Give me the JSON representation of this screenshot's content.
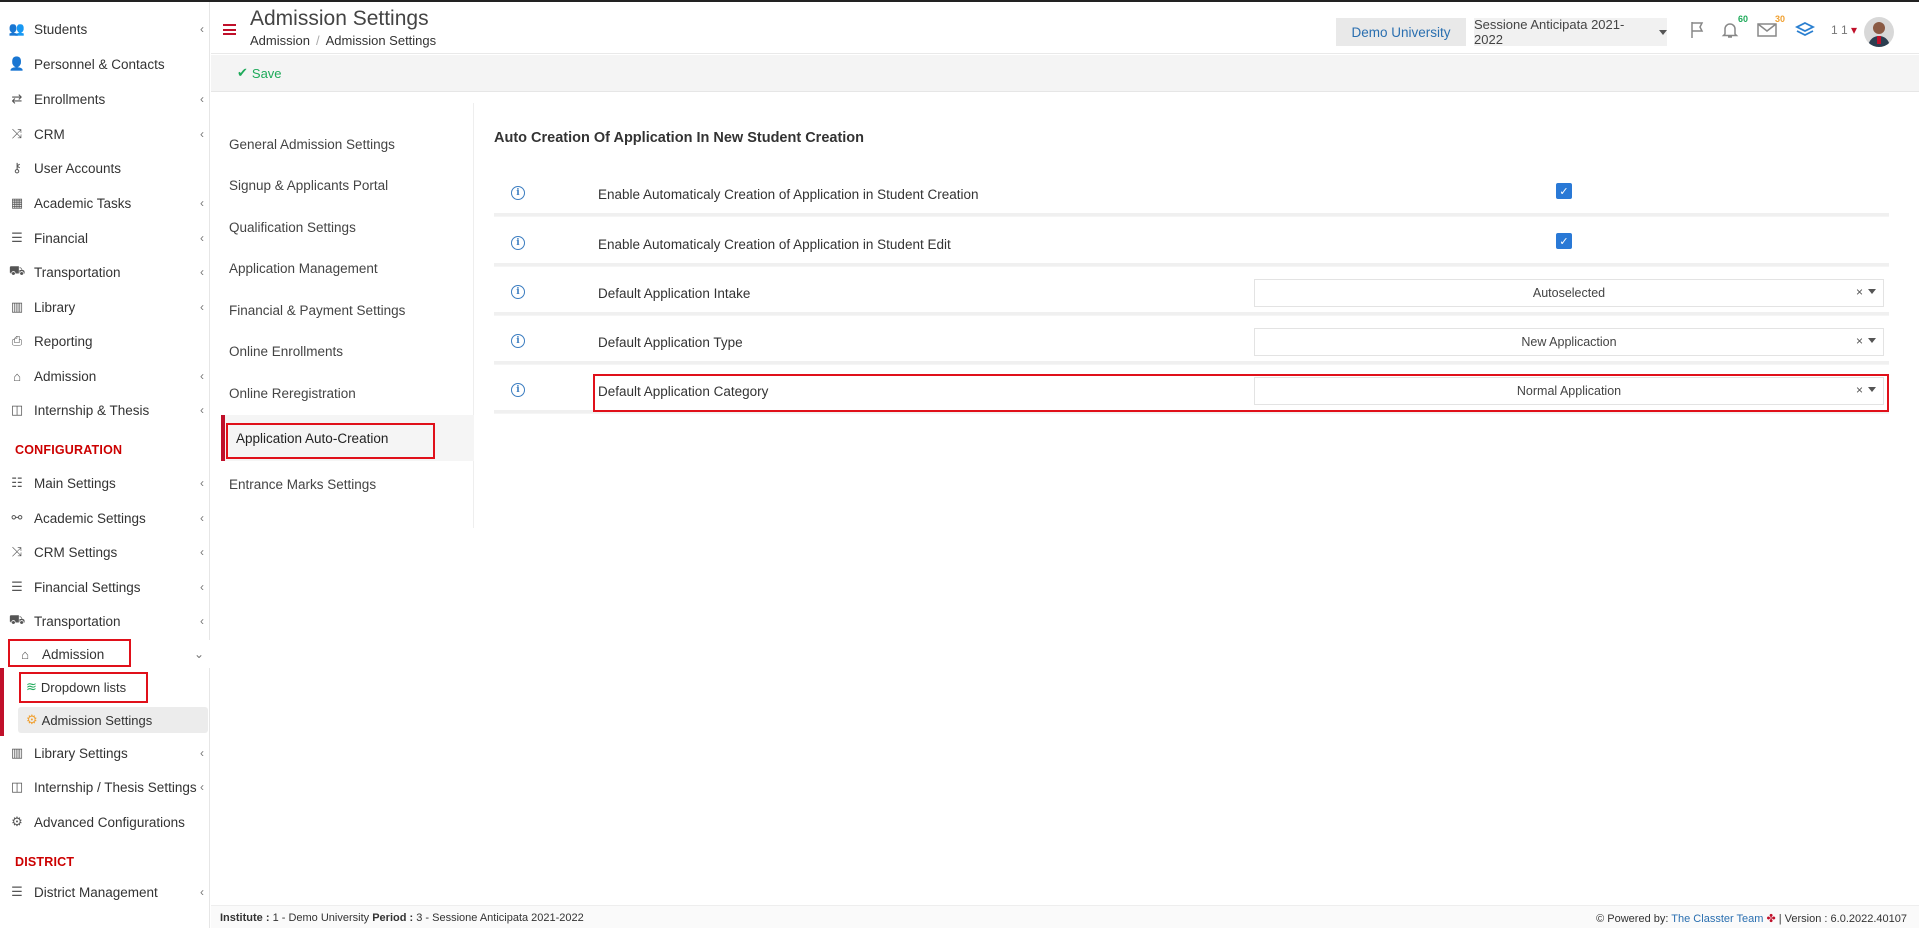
{
  "header": {
    "title": "Admission Settings",
    "breadcrumb": [
      "Admission",
      "Admission Settings"
    ],
    "institution": "Demo University",
    "session": "Sessione Anticipata 2021-2022",
    "notifications_badge": "60",
    "messages_badge": "30",
    "user_number": "1 1"
  },
  "toolbar": {
    "save_label": "Save"
  },
  "sidebar": {
    "items": [
      {
        "label": "Students",
        "icon": "users-icon",
        "chev": true
      },
      {
        "label": "Personnel & Contacts",
        "icon": "user-tie-icon",
        "chev": false
      },
      {
        "label": "Enrollments",
        "icon": "exchange-icon",
        "chev": true
      },
      {
        "label": "CRM",
        "icon": "shuffle-icon",
        "chev": true
      },
      {
        "label": "User Accounts",
        "icon": "key-icon",
        "chev": false
      },
      {
        "label": "Academic Tasks",
        "icon": "grid-icon",
        "chev": true
      },
      {
        "label": "Financial",
        "icon": "coins-icon",
        "chev": true
      },
      {
        "label": "Transportation",
        "icon": "bus-icon",
        "chev": true
      },
      {
        "label": "Library",
        "icon": "books-icon",
        "chev": true
      },
      {
        "label": "Reporting",
        "icon": "print-icon",
        "chev": false
      },
      {
        "label": "Admission",
        "icon": "bank-icon",
        "chev": true
      },
      {
        "label": "Internship & Thesis",
        "icon": "box-icon",
        "chev": true
      }
    ],
    "config_heading": "CONFIGURATION",
    "config_items": [
      {
        "label": "Main Settings",
        "icon": "sliders-icon",
        "chev": true
      },
      {
        "label": "Academic Settings",
        "icon": "org-icon",
        "chev": true
      },
      {
        "label": "CRM Settings",
        "icon": "shuffle-icon",
        "chev": true
      },
      {
        "label": "Financial Settings",
        "icon": "coins-icon",
        "chev": true
      },
      {
        "label": "Transportation",
        "icon": "bus-icon",
        "chev": true
      },
      {
        "label": "Admission",
        "icon": "bank-icon",
        "chev": true
      },
      {
        "label": "Library Settings",
        "icon": "books-icon",
        "chev": true
      },
      {
        "label": "Internship / Thesis Settings",
        "icon": "box-icon",
        "chev": true
      },
      {
        "label": "Advanced Configurations",
        "icon": "gears-icon",
        "chev": false
      }
    ],
    "sub_items": [
      {
        "label": "Dropdown lists",
        "icon": "layers-icon"
      },
      {
        "label": "Admission Settings",
        "icon": "gear-icon"
      }
    ],
    "district_heading": "DISTRICT",
    "district_items": [
      {
        "label": "District Management",
        "icon": "list-icon",
        "chev": true
      }
    ]
  },
  "settings_nav": [
    "General Admission Settings",
    "Signup & Applicants Portal",
    "Qualification Settings",
    "Application Management",
    "Financial & Payment Settings",
    "Online Enrollments",
    "Online Reregistration",
    "Application Auto-Creation",
    "Entrance Marks Settings"
  ],
  "main": {
    "section_title": "Auto Creation Of Application In New Student Creation",
    "rows": [
      {
        "label": "Enable Automaticaly Creation of Application in Student Creation",
        "type": "checkbox",
        "checked": true
      },
      {
        "label": "Enable Automaticaly Creation of Application in Student Edit",
        "type": "checkbox",
        "checked": true
      },
      {
        "label": "Default Application Intake",
        "type": "select",
        "value": "Autoselected"
      },
      {
        "label": "Default Application Type",
        "type": "select",
        "value": "New Applicaction"
      },
      {
        "label": "Default Application Category",
        "type": "select",
        "value": "Normal Application"
      }
    ]
  },
  "footer": {
    "institute_label": "Institute :",
    "institute_value": "1 - Demo University",
    "period_label": "Period :",
    "period_value": "3 - Sessione Anticipata 2021-2022",
    "powered_by": "Powered by:",
    "team": "The Classter Team",
    "version": "| Version : 6.0.2022.40107"
  },
  "colors": {
    "accent": "#c0102a",
    "link": "#2a6fb0",
    "save": "#1eaa5a",
    "checkbox": "#2979d6",
    "highlight": "#e0101a"
  }
}
